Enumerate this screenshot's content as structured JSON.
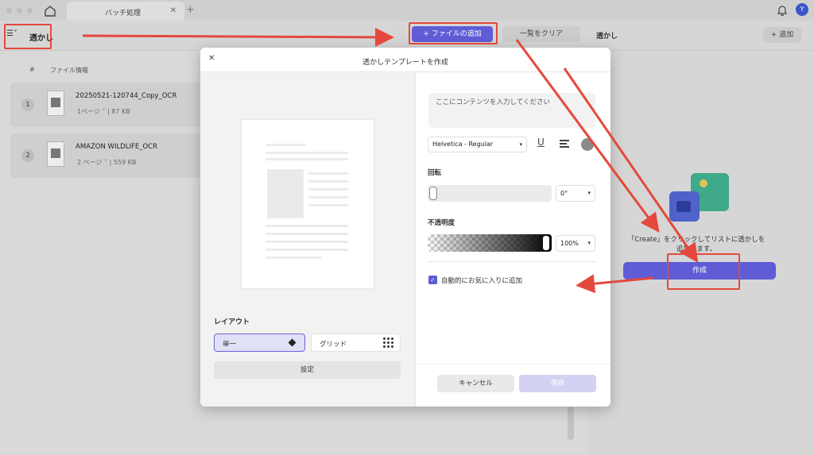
{
  "tab": {
    "title": "バッチ処理",
    "close": "✕",
    "add": "+"
  },
  "user": {
    "initial": "Y"
  },
  "toolbar": {
    "menu_glyph": "☰˅",
    "mode": "透かし",
    "add_file": "+ ファイルの追加",
    "clear": "一覧をクリア",
    "panel_title": "透かし",
    "panel_add": "+ 追加"
  },
  "file_list": {
    "headers": {
      "index": "#",
      "info": "ファイル情報"
    },
    "rows": [
      {
        "index": "1",
        "name": "20250521-120744_Copy_OCR",
        "pages": "1ページ ˅",
        "size": "87 KB"
      },
      {
        "index": "2",
        "name": "AMAZON WILDLIFE_OCR",
        "pages": "2 ページ ˅",
        "size": "559 KB"
      }
    ]
  },
  "side": {
    "hint": "「Create」をクリックしてリストに透かしを追加します。",
    "create": "作成"
  },
  "modal": {
    "close": "✕",
    "title": "透かしテンプレートを作成",
    "content_placeholder": "ここにコンテンツを入力してください",
    "font": "Helvetica - Regular",
    "underline": "U",
    "rotation_label": "回転",
    "rotation_value": "0°",
    "opacity_label": "不透明度",
    "opacity_value": "100%",
    "opacity_level": 1.0,
    "auto_favorite": "自動的にお気に入りに追加",
    "auto_favorite_checked": true,
    "layout_label": "レイアウト",
    "layout_single": "単一",
    "layout_grid": "グリッド",
    "settings": "設定",
    "cancel": "キャンセル",
    "save": "保存"
  },
  "colors": {
    "accent": "#5f5cd6",
    "annotation": "#e5483d"
  },
  "icons": [
    "home-icon",
    "bell-icon",
    "menu-icon",
    "close-icon",
    "underline-icon",
    "align-icon",
    "color-swatch-icon",
    "diamond-icon",
    "grid-icon",
    "checkmark-icon"
  ]
}
